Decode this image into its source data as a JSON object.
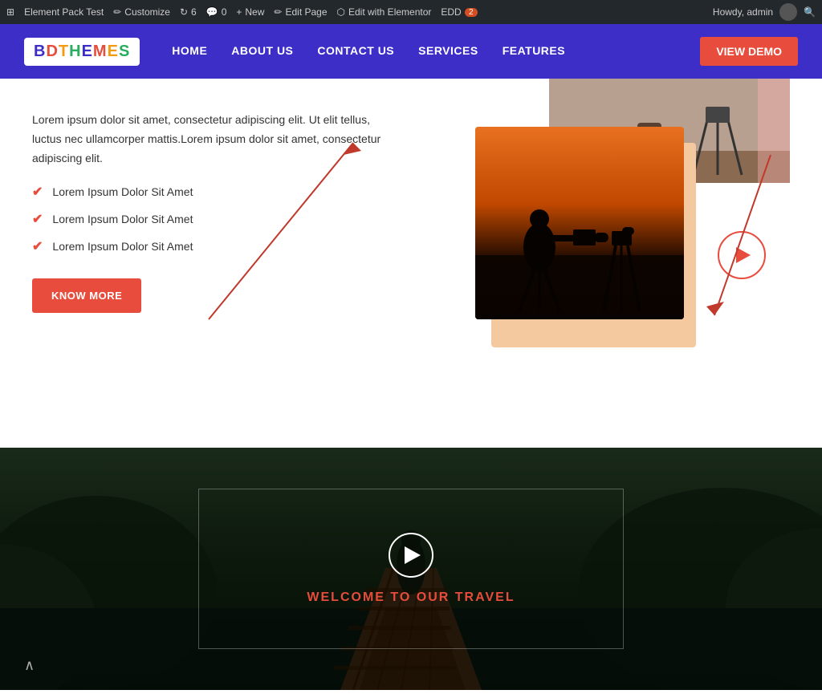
{
  "adminBar": {
    "wpIcon": "⊞",
    "siteTitle": "Element Pack Test",
    "customize": "Customize",
    "revisions": "6",
    "comments": "0",
    "new": "New",
    "editPage": "Edit Page",
    "editWithElementor": "Edit with Elementor",
    "edd": "EDD",
    "eddBadge": "2",
    "howdy": "Howdy, admin"
  },
  "nav": {
    "logo": "BDTHEMES",
    "links": [
      "HOME",
      "ABOUT US",
      "CONTACT US",
      "SERVICES",
      "FEATURES"
    ],
    "viewDemo": "View Demo"
  },
  "leftSection": {
    "paragraph": "Lorem ipsum dolor sit amet, consectetur adipiscing elit. Ut elit tellus, luctus nec ullamcorper mattis.Lorem ipsum dolor sit amet, consectetur adipiscing elit.",
    "checklist": [
      "Lorem Ipsum Dolor Sit Amet",
      "Lorem Ipsum Dolor Sit Amet",
      "Lorem Ipsum Dolor Sit Amet"
    ],
    "knowMore": "KNOW MORE"
  },
  "videoSection": {
    "playLabel": "▶",
    "welcomeText": "WELCOME TO OUR TRAVEL"
  },
  "scrollArrow": "∧",
  "colors": {
    "navBg": "#3d2ec8",
    "accent": "#e74c3c",
    "white": "#ffffff"
  }
}
